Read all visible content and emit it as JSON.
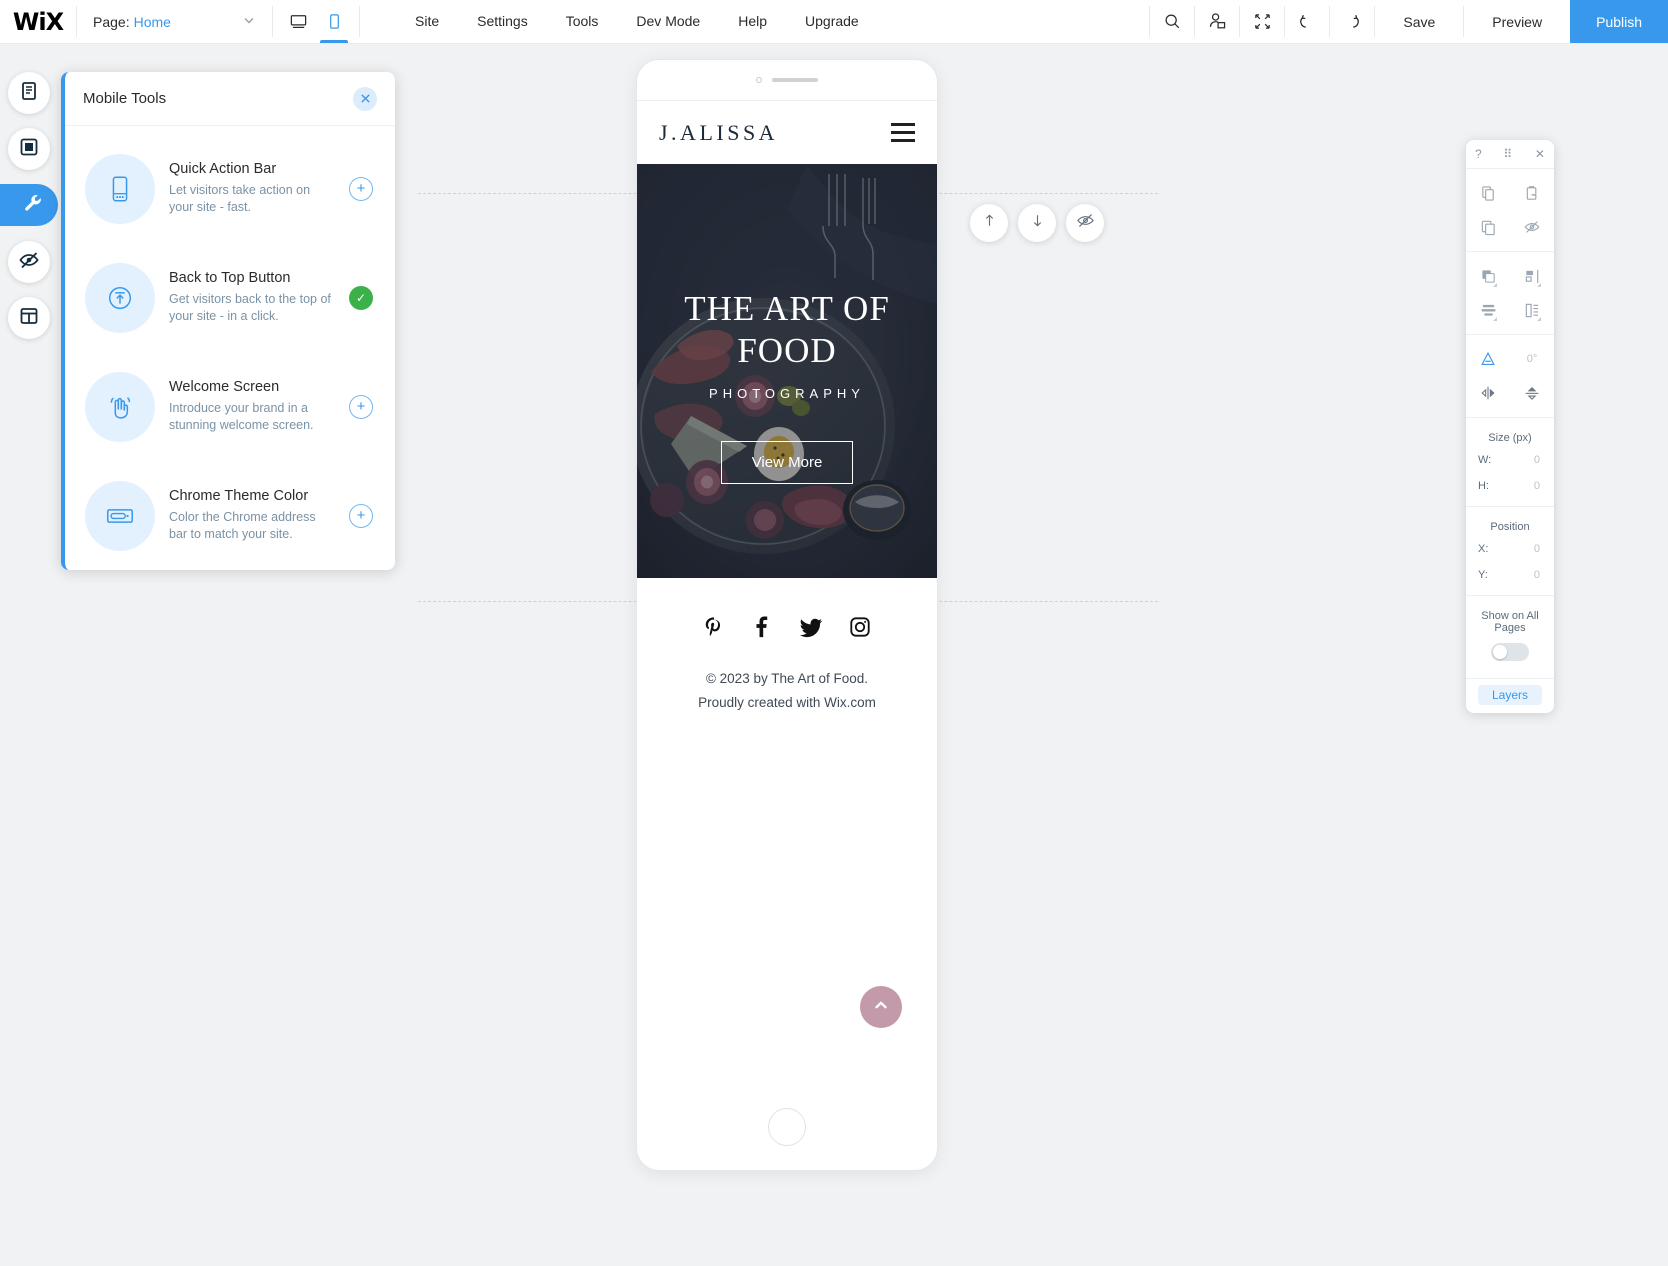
{
  "topbar": {
    "logo": "WiX",
    "page_label": "Page:",
    "page_value": "Home",
    "chevron_icon": "chevron-down-icon",
    "view_desktop_icon": "desktop-icon",
    "view_mobile_icon": "mobile-icon",
    "menu": [
      {
        "label": "Site"
      },
      {
        "label": "Settings"
      },
      {
        "label": "Tools"
      },
      {
        "label": "Dev Mode"
      },
      {
        "label": "Help"
      },
      {
        "label": "Upgrade"
      }
    ],
    "search_icon": "search-icon",
    "collaborators_icon": "user-add-icon",
    "zoomout_icon": "zoom-out-icon",
    "undo_icon": "undo-icon",
    "redo_icon": "redo-icon",
    "save_label": "Save",
    "preview_label": "Preview",
    "publish_label": "Publish"
  },
  "left_rail": [
    {
      "name": "menus-and-pages",
      "icon": "pages-icon",
      "active": false
    },
    {
      "name": "background",
      "icon": "background-icon",
      "active": false
    },
    {
      "name": "mobile-tools",
      "icon": "wrench-icon",
      "active": true
    },
    {
      "name": "hidden-elements",
      "icon": "eye-hidden-icon",
      "active": false
    },
    {
      "name": "layout-optimizer",
      "icon": "layout-icon",
      "active": false
    }
  ],
  "mobile_tools": {
    "title": "Mobile Tools",
    "close_icon": "close-icon",
    "items": [
      {
        "name": "Quick Action Bar",
        "desc": "Let visitors take action on your site - fast.",
        "icon": "quick-action-bar-icon",
        "action": "+",
        "state": "add"
      },
      {
        "name": "Back to Top Button",
        "desc": "Get visitors back to the top of your site - in a click.",
        "icon": "back-to-top-icon",
        "action": "✓",
        "state": "added"
      },
      {
        "name": "Welcome Screen",
        "desc": "Introduce your brand in a stunning welcome screen.",
        "icon": "waving-hand-icon",
        "action": "+",
        "state": "add"
      },
      {
        "name": "Chrome Theme Color",
        "desc": "Color the Chrome address bar to match your site.",
        "icon": "address-bar-icon",
        "action": "+",
        "state": "add"
      }
    ]
  },
  "canvas_controls": [
    {
      "name": "move-up-button",
      "icon": "arrow-up-icon"
    },
    {
      "name": "move-down-button",
      "icon": "arrow-down-icon"
    },
    {
      "name": "hide-element-button",
      "icon": "eye-hidden-icon"
    }
  ],
  "phone": {
    "brand": "J.ALISSA",
    "menu_icon": "hamburger-menu-icon",
    "hero": {
      "title_line1": "THE ART OF",
      "title_line2": "FOOD",
      "subtitle": "PHOTOGRAPHY",
      "cta_label": "View More"
    },
    "socials": [
      {
        "name": "pinterest-icon",
        "glyph": "𝑷"
      },
      {
        "name": "facebook-icon",
        "glyph": "f"
      },
      {
        "name": "twitter-icon",
        "glyph": "t"
      },
      {
        "name": "instagram-icon",
        "glyph": "i"
      }
    ],
    "copyright_line1": "© 2023 by The Art of Food.",
    "copyright_line2": "Proudly created with Wix.com",
    "back_to_top_icon": "chevron-up-icon"
  },
  "right_toolbar": {
    "help_icon": "question-mark-icon",
    "grip_icon": "drag-grip-icon",
    "close_icon": "close-icon",
    "rows": [
      [
        {
          "name": "copy-button",
          "icon": "copy-icon",
          "enabled": true
        },
        {
          "name": "paste-button",
          "icon": "paste-icon",
          "enabled": true
        }
      ],
      [
        {
          "name": "duplicate-button",
          "icon": "duplicate-icon",
          "enabled": true
        },
        {
          "name": "hide-button",
          "icon": "eye-hidden-icon",
          "enabled": true
        }
      ]
    ],
    "arrange_rows": [
      [
        {
          "name": "arrange-button",
          "icon": "arrange-icon",
          "enabled": true,
          "caret": true
        },
        {
          "name": "align-button",
          "icon": "align-icon",
          "enabled": true,
          "caret": true
        }
      ],
      [
        {
          "name": "distribute-button",
          "icon": "distribute-icon",
          "enabled": true,
          "caret": true
        },
        {
          "name": "match-size-button",
          "icon": "match-size-icon",
          "enabled": true,
          "caret": true
        }
      ]
    ],
    "rotate_row": [
      {
        "name": "rotate-button",
        "icon": "rotate-icon",
        "blue": true
      },
      {
        "name": "rotation-value",
        "value": "0°"
      }
    ],
    "flip_row": [
      {
        "name": "flip-horizontal-button",
        "icon": "flip-horizontal-icon"
      },
      {
        "name": "flip-vertical-button",
        "icon": "flip-vertical-icon"
      }
    ],
    "size_label": "Size (px)",
    "size_fields": [
      {
        "key": "W:",
        "value": "0"
      },
      {
        "key": "H:",
        "value": "0"
      }
    ],
    "position_label": "Position",
    "position_fields": [
      {
        "key": "X:",
        "value": "0"
      },
      {
        "key": "Y:",
        "value": "0"
      }
    ],
    "show_all_label": "Show on All Pages",
    "toggle_state": "off",
    "layers_label": "Layers"
  },
  "colors": {
    "accent": "#3899ec",
    "added_green": "#3bb14a",
    "back_to_top": "#c39aaa",
    "hero_dark": "#2d3442",
    "canvas_bg": "#f0f2f4"
  }
}
